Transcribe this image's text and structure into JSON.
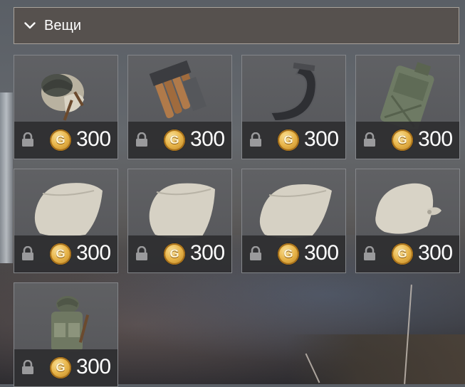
{
  "section": {
    "title": "Вещи",
    "expanded": true,
    "chevron_icon": "chevron-down-icon"
  },
  "currency": {
    "symbol": "G",
    "icon": "gold-coin-icon",
    "coin_color": "#e8b54a"
  },
  "items": [
    {
      "kind": "helmet-backpack",
      "icon": "lock-icon",
      "price": "300",
      "locked": true
    },
    {
      "kind": "ammo-clip",
      "icon": "lock-icon",
      "price": "300",
      "locked": true
    },
    {
      "kind": "horseshoe",
      "icon": "lock-icon",
      "price": "300",
      "locked": true
    },
    {
      "kind": "jerrycan",
      "icon": "lock-icon",
      "price": "300",
      "locked": true
    },
    {
      "kind": "sandbag",
      "icon": "lock-icon",
      "price": "300",
      "locked": true
    },
    {
      "kind": "sandbag",
      "icon": "lock-icon",
      "price": "300",
      "locked": true
    },
    {
      "kind": "sandbag",
      "icon": "lock-icon",
      "price": "300",
      "locked": true
    },
    {
      "kind": "tied-sack",
      "icon": "lock-icon",
      "price": "300",
      "locked": true
    },
    {
      "kind": "soldier-pack",
      "icon": "lock-icon",
      "price": "300",
      "locked": true
    }
  ]
}
